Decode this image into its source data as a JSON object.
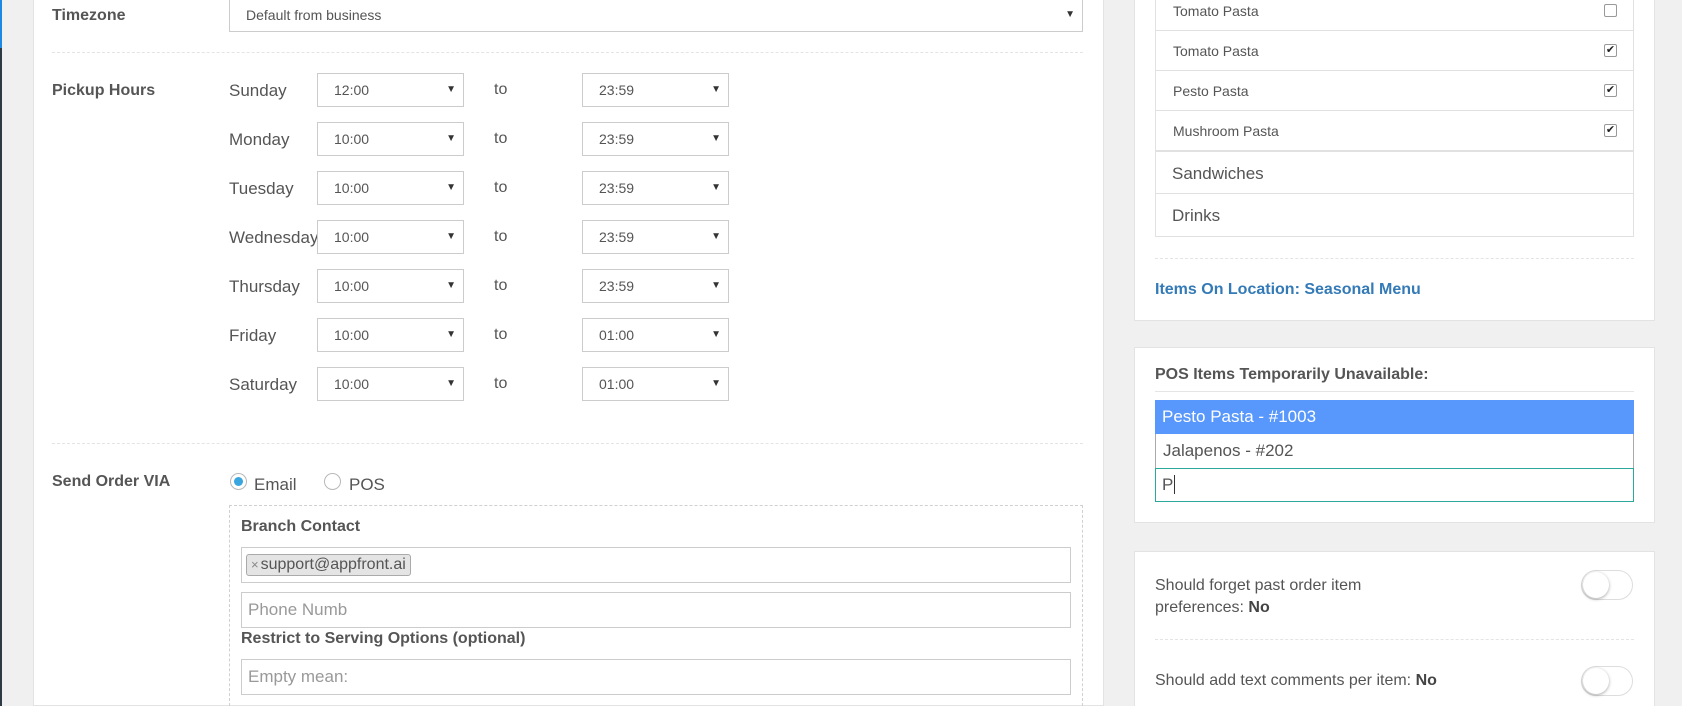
{
  "timezone": {
    "label": "Timezone",
    "value": "Default from business"
  },
  "pickup": {
    "label": "Pickup Hours",
    "to_label": "to",
    "days": [
      {
        "day": "Sunday",
        "from": "12:00",
        "to": "23:59"
      },
      {
        "day": "Monday",
        "from": "10:00",
        "to": "23:59"
      },
      {
        "day": "Tuesday",
        "from": "10:00",
        "to": "23:59"
      },
      {
        "day": "Wednesday",
        "from": "10:00",
        "to": "23:59"
      },
      {
        "day": "Thursday",
        "from": "10:00",
        "to": "23:59"
      },
      {
        "day": "Friday",
        "from": "10:00",
        "to": "01:00"
      },
      {
        "day": "Saturday",
        "from": "10:00",
        "to": "01:00"
      }
    ]
  },
  "send_order": {
    "label": "Send Order VIA",
    "options": [
      {
        "label": "Email",
        "selected": true
      },
      {
        "label": "POS",
        "selected": false
      }
    ]
  },
  "branch_contact": {
    "label": "Branch Contact",
    "email_tag": "support@appfront.ai",
    "phone_placeholder": "Phone Numb",
    "restrict_label": "Restrict to Serving Options (optional)",
    "restrict_placeholder": "Empty mean:"
  },
  "menu": {
    "items": [
      {
        "label": "Tomato Pasta",
        "checked": false
      },
      {
        "label": "Tomato Pasta",
        "checked": true
      },
      {
        "label": "Pesto Pasta",
        "checked": true
      },
      {
        "label": "Mushroom Pasta",
        "checked": true
      }
    ],
    "groups": [
      "Sandwiches",
      "Drinks"
    ],
    "link": "Items On Location: Seasonal Menu"
  },
  "pos_unavailable": {
    "label": "POS Items Temporarily Unavailable:",
    "options": [
      "Pesto Pasta - #1003",
      "Jalapenos - #202"
    ],
    "search_value": "P"
  },
  "preferences": {
    "forget_text": "Should forget past order item preferences:",
    "forget_value": "No",
    "comments_text": "Should add text comments per item:",
    "comments_value": "No"
  },
  "colors": {
    "accent": "#337ab7",
    "selection": "#5897fb",
    "focus": "#2aa89b",
    "radio": "#3aa6e0"
  },
  "icons": {
    "dropdown": "caret-down-icon",
    "check": "check-icon",
    "remove": "close-icon"
  }
}
